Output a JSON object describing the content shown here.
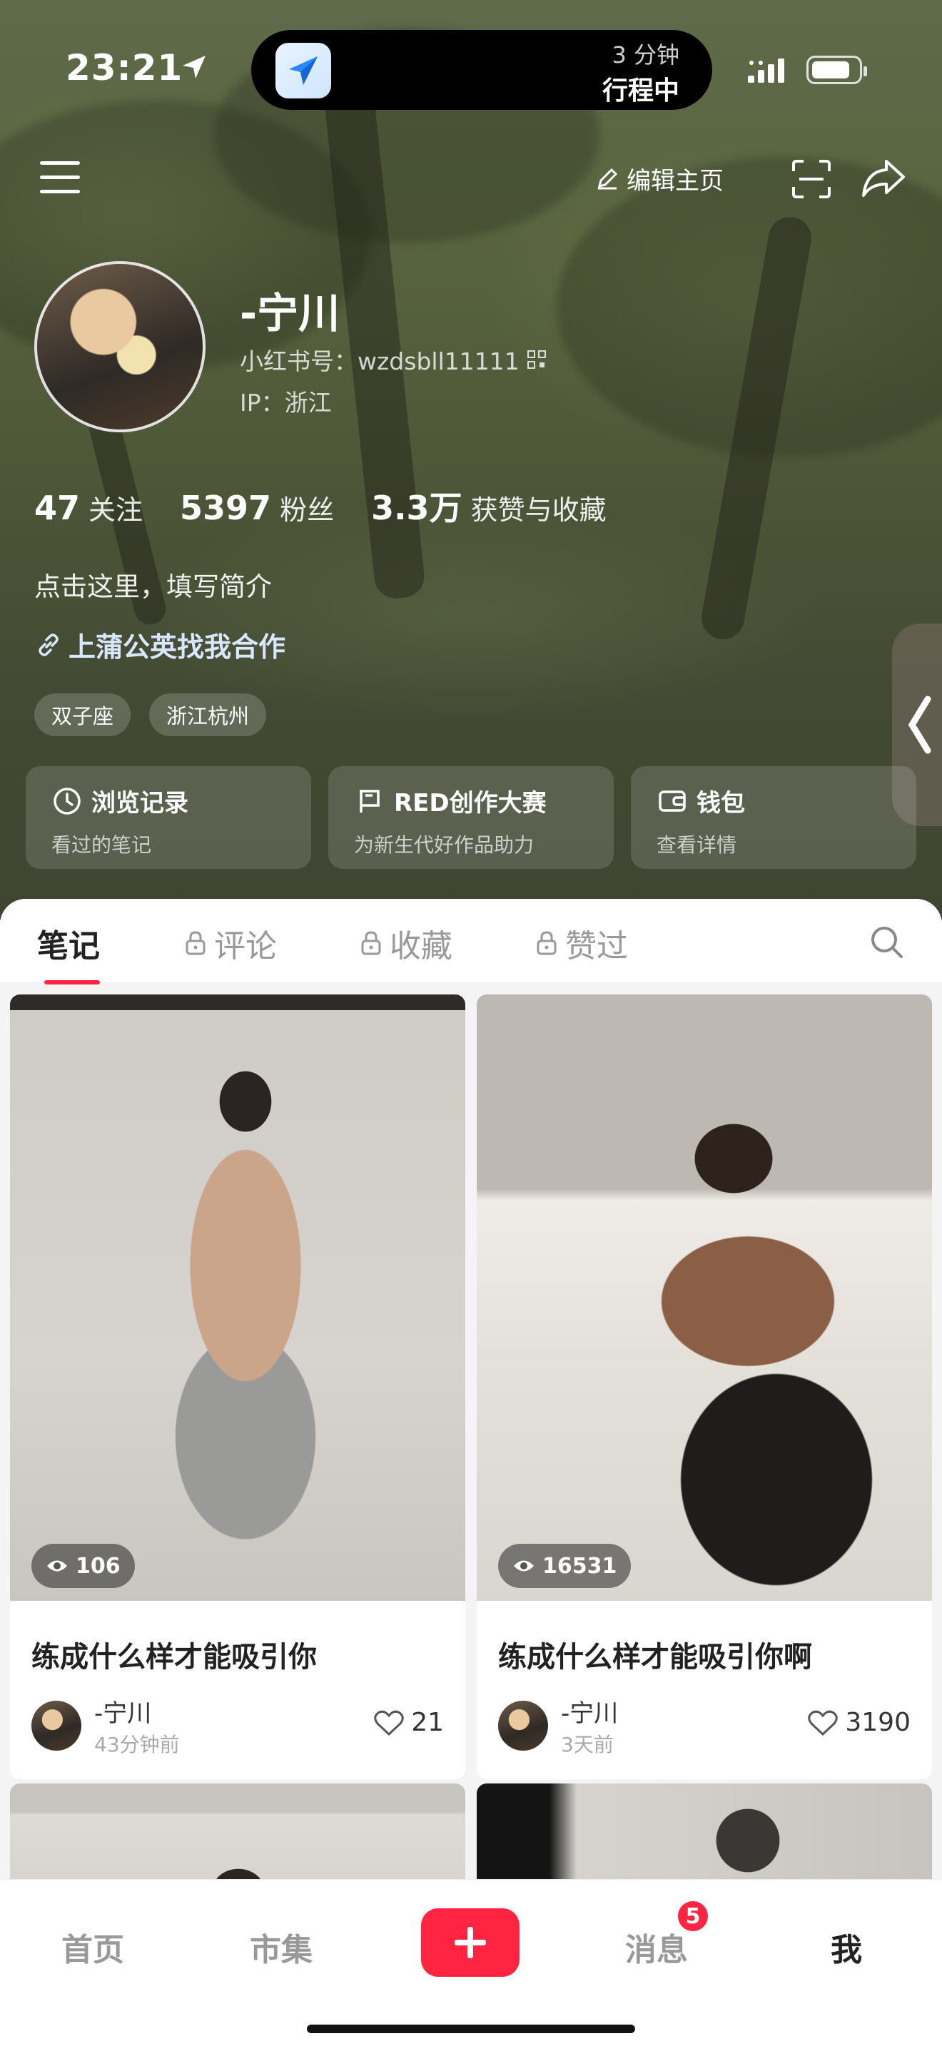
{
  "status_bar": {
    "time": "23:21",
    "eta": "3 分钟",
    "trip": "行程中"
  },
  "header": {
    "edit_label": "编辑主页"
  },
  "profile": {
    "nickname": "-宁川",
    "red_id": "小红书号：wzdsbll11111",
    "ip": "IP：浙江",
    "stats": [
      {
        "num": "47",
        "label": "关注"
      },
      {
        "num": "5397",
        "label": "粉丝"
      },
      {
        "num": "3.3万",
        "label": "获赞与收藏"
      }
    ],
    "bio": "点击这里，填写简介",
    "collab": "上蒲公英找我合作",
    "tags": [
      "双子座",
      "浙江杭州"
    ]
  },
  "quick_links": [
    {
      "title": "浏览记录",
      "sub": "看过的笔记",
      "icon": "clock-icon"
    },
    {
      "title": "RED创作大赛",
      "sub": "为新生代好作品助力",
      "icon": "flag-icon"
    },
    {
      "title": "钱包",
      "sub": "查看详情",
      "icon": "wallet-icon"
    }
  ],
  "tabs": [
    {
      "label": "笔记",
      "locked": false
    },
    {
      "label": "评论",
      "locked": true
    },
    {
      "label": "收藏",
      "locked": true
    },
    {
      "label": "赞过",
      "locked": true
    }
  ],
  "notes": [
    {
      "views": "106",
      "title": "练成什么样才能吸引你",
      "author": "-宁川",
      "time": "43分钟前",
      "likes": "21"
    },
    {
      "views": "16531",
      "title": "练成什么样才能吸引你啊",
      "author": "-宁川",
      "time": "3天前",
      "likes": "3190"
    }
  ],
  "bottom_nav": {
    "home": "首页",
    "market": "市集",
    "messages": "消息",
    "messages_badge": "5",
    "me": "我"
  },
  "colors": {
    "accent": "#ff2442",
    "hero_bg": "#4e5738"
  }
}
